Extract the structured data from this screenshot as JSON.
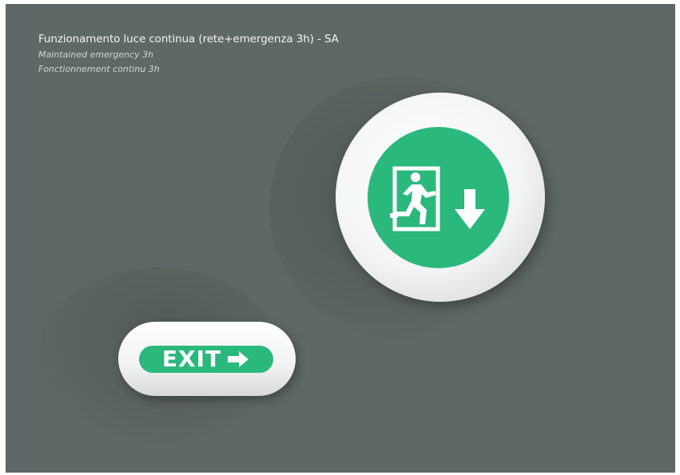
{
  "header": {
    "title": "Funzionamento luce continua (rete+emergenza 3h) - SA",
    "subtitle_en": "Maintained emergency 3h",
    "subtitle_fr": "Fonctionnement continu 3h"
  },
  "colors": {
    "background": "#5f6866",
    "sign_green": "#2bb87d",
    "fixture_white": "#f3f4f4"
  },
  "round_luminaire": {
    "pictogram": "running-man-door-icon",
    "arrow": "arrow-down-icon"
  },
  "exit_luminaire": {
    "label": "EXIT",
    "arrow": "arrow-right-icon"
  }
}
